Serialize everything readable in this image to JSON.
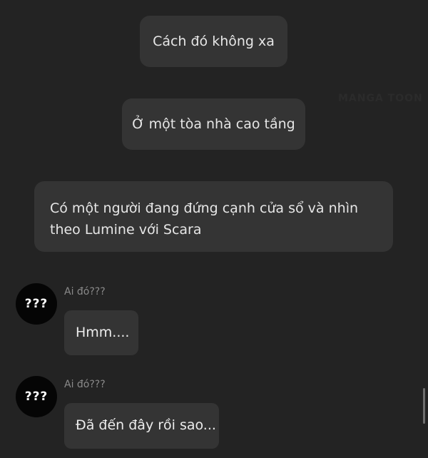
{
  "narrations": [
    "Cách đó không xa",
    "Ở một tòa nhà cao tầng",
    "Có một người đang đứng cạnh cửa sổ và nhìn theo Lumine với Scara"
  ],
  "watermark": "MANGA TOON",
  "messages": [
    {
      "avatar_text": "???",
      "sender": "Ai đó???",
      "text": "Hmm...."
    },
    {
      "avatar_text": "???",
      "sender": "Ai đó???",
      "text": "Đã đến đây rồi sao..."
    }
  ],
  "colors": {
    "background": "#232323",
    "bubble": "#343434",
    "avatar": "#050505",
    "sender_text": "#8a8a8a"
  }
}
